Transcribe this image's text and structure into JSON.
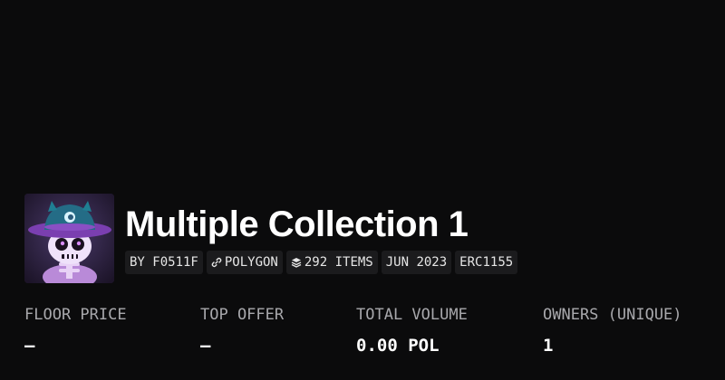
{
  "collection": {
    "title": "Multiple Collection 1"
  },
  "chips": {
    "creator": "BY F0511F",
    "chain": "POLYGON",
    "chain_icon": "link-icon",
    "items": "292 ITEMS",
    "items_icon": "layers-icon",
    "date": "JUN 2023",
    "standard": "ERC1155"
  },
  "stats": {
    "floor_price": {
      "label": "FLOOR PRICE",
      "value": "—"
    },
    "top_offer": {
      "label": "TOP OFFER",
      "value": "—"
    },
    "total_volume": {
      "label": "TOTAL VOLUME",
      "value": "0.00 POL"
    },
    "owners": {
      "label": "OWNERS (UNIQUE)",
      "value": "1"
    }
  },
  "colors": {
    "background": "#0b0b0c",
    "chip_background": "#1b1b1d",
    "label": "#a8a8ac"
  }
}
